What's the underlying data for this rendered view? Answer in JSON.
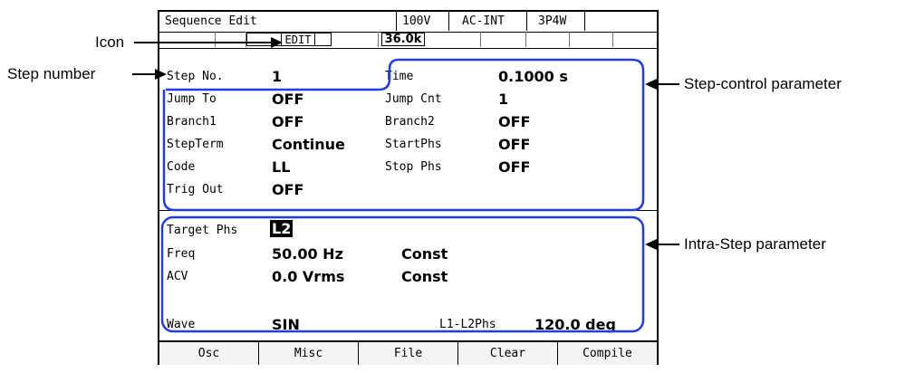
{
  "header": {
    "title": "Sequence Edit",
    "voltage_range": "100V",
    "source": "AC-INT",
    "wiring": "3P4W"
  },
  "icon_row": {
    "edit_badge": "EDIT",
    "counter": "36.0k"
  },
  "step_control": {
    "step_no_label": "Step No.",
    "step_no_value": "1",
    "time_label": "Time",
    "time_value": "0.1000 s",
    "jump_to_label": "Jump To",
    "jump_to_value": "OFF",
    "jump_cnt_label": "Jump Cnt",
    "jump_cnt_value": "1",
    "branch1_label": "Branch1",
    "branch1_value": "OFF",
    "branch2_label": "Branch2",
    "branch2_value": "OFF",
    "stepterm_label": "StepTerm",
    "stepterm_value": "Continue",
    "startphs_label": "StartPhs",
    "startphs_value": "OFF",
    "code_label": "Code",
    "code_value": "LL",
    "stopphs_label": "Stop Phs",
    "stopphs_value": "OFF",
    "trigout_label": "Trig Out",
    "trigout_value": "OFF"
  },
  "intra_step": {
    "target_phs_label": "Target Phs",
    "target_phs_value": "L2",
    "freq_label": "Freq",
    "freq_value": "50.00 Hz",
    "freq_mode": "Const",
    "acv_label": "ACV",
    "acv_value": "0.0 Vrms",
    "acv_mode": "Const",
    "wave_label": "Wave",
    "wave_value": "SIN",
    "l1l2phs_label": "L1-L2Phs",
    "l1l2phs_value": "120.0 deg"
  },
  "softkeys": [
    "Osc",
    "Misc",
    "File",
    "Clear",
    "Compile"
  ],
  "annotations": {
    "icon": "Icon",
    "step_number": "Step number",
    "step_control": "Step-control parameter",
    "intra_step": "Intra-Step parameter"
  },
  "colors": {
    "annotation_blue": "#1f3cf0",
    "highlight_bg": "#000000"
  }
}
